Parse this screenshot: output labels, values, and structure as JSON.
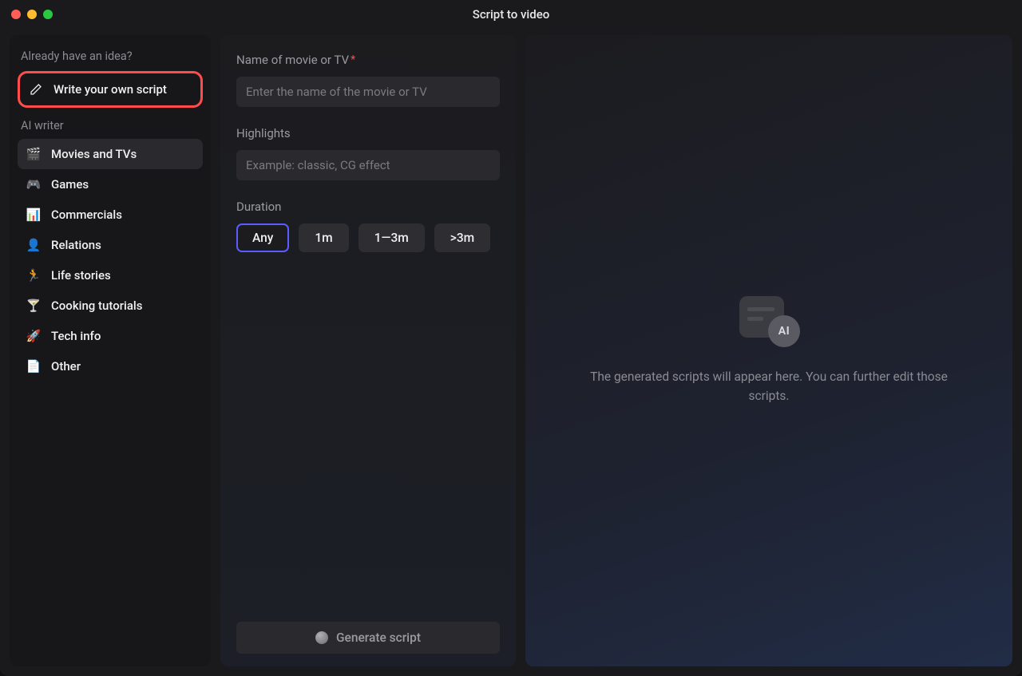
{
  "window": {
    "title": "Script to video"
  },
  "sidebar": {
    "idea_label": "Already have an idea?",
    "write_own": "Write your own script",
    "ai_writer_label": "AI writer",
    "items": [
      {
        "label": "Movies and TVs",
        "icon": "🎬"
      },
      {
        "label": "Games",
        "icon": "🎮"
      },
      {
        "label": "Commercials",
        "icon": "📊"
      },
      {
        "label": "Relations",
        "icon": "👤"
      },
      {
        "label": "Life stories",
        "icon": "🏃"
      },
      {
        "label": "Cooking tutorials",
        "icon": "🍸"
      },
      {
        "label": "Tech info",
        "icon": "🚀"
      },
      {
        "label": "Other",
        "icon": "📄"
      }
    ]
  },
  "form": {
    "name_label": "Name of movie or TV",
    "name_placeholder": "Enter the name of the movie or TV",
    "highlights_label": "Highlights",
    "highlights_placeholder": "Example: classic, CG effect",
    "duration_label": "Duration",
    "durations": [
      "Any",
      "1m",
      "1—3m",
      ">3m"
    ],
    "selected_duration": "Any",
    "generate_label": "Generate script"
  },
  "right": {
    "ai_badge": "AI",
    "placeholder": "The generated scripts will appear here. You can further edit those scripts."
  }
}
